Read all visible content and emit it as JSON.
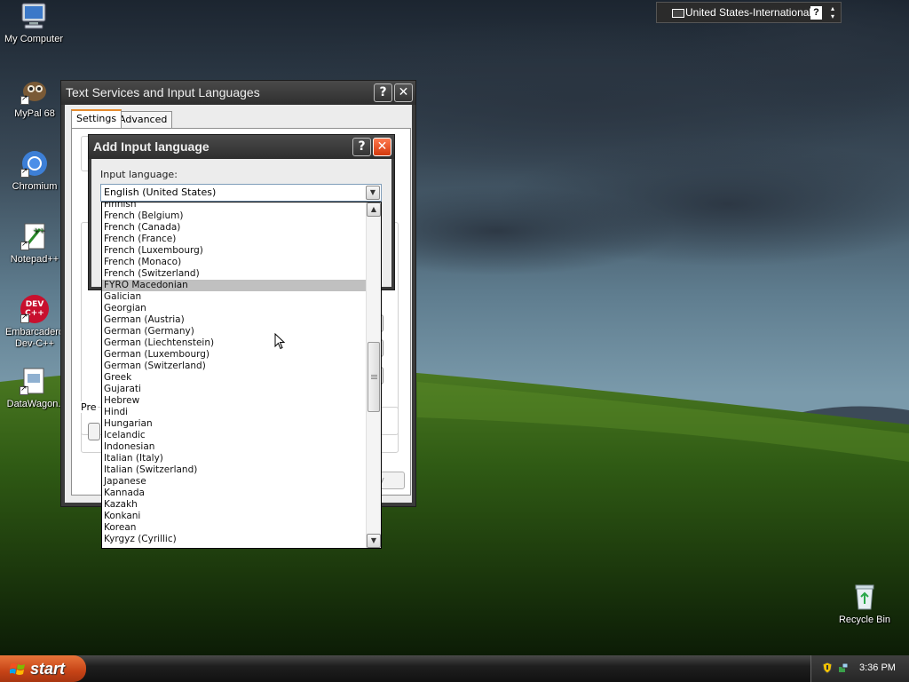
{
  "desktop_icons": [
    {
      "label": "My Computer",
      "icon": "my-computer-icon"
    },
    {
      "label": "MyPal 68",
      "icon": "mypal-icon"
    },
    {
      "label": "Chromium",
      "icon": "chromium-icon"
    },
    {
      "label": "Notepad++",
      "icon": "notepad-plus-plus-icon"
    },
    {
      "label": "Embarcadero Dev-C++",
      "line1": "Embarcadero",
      "line2": "Dev-C++",
      "icon": "devcpp-icon",
      "icon_text_top": "DEV",
      "icon_text_bottom": "C++"
    },
    {
      "label": "DataWagon.",
      "icon": "datawagon-icon"
    },
    {
      "label": "Recycle Bin",
      "icon": "recycle-bin-icon"
    }
  ],
  "langbar": {
    "language": "United States-International",
    "help": "?"
  },
  "tsil_window": {
    "title": "Text Services and Input Languages",
    "help_button": "?",
    "close_button": "✕",
    "tabs": [
      {
        "label": "Settings",
        "active": true
      },
      {
        "label": "Advanced",
        "active": false
      }
    ],
    "partial_label": "Pre",
    "partial_button": "y"
  },
  "add_input_language": {
    "title": "Add Input language",
    "help_button": "?",
    "close_button": "✕",
    "input_language_label": "Input language:",
    "selected_value": "English (United States)",
    "list_items": [
      "Finnish",
      "French (Belgium)",
      "French (Canada)",
      "French (France)",
      "French (Luxembourg)",
      "French (Monaco)",
      "French (Switzerland)",
      "FYRO Macedonian",
      "Galician",
      "Georgian",
      "German (Austria)",
      "German (Germany)",
      "German (Liechtenstein)",
      "German (Luxembourg)",
      "German (Switzerland)",
      "Greek",
      "Gujarati",
      "Hebrew",
      "Hindi",
      "Hungarian",
      "Icelandic",
      "Indonesian",
      "Italian (Italy)",
      "Italian (Switzerland)",
      "Japanese",
      "Kannada",
      "Kazakh",
      "Konkani",
      "Korean",
      "Kyrgyz (Cyrillic)"
    ],
    "highlighted_item": "FYRO Macedonian"
  },
  "taskbar": {
    "start_label": "start",
    "clock": "3:36 PM"
  },
  "colors": {
    "start_button": "#c64316",
    "window_frame": "#3b3b3b",
    "highlight": "#c0c0c0",
    "title_close": "#d3380c"
  }
}
